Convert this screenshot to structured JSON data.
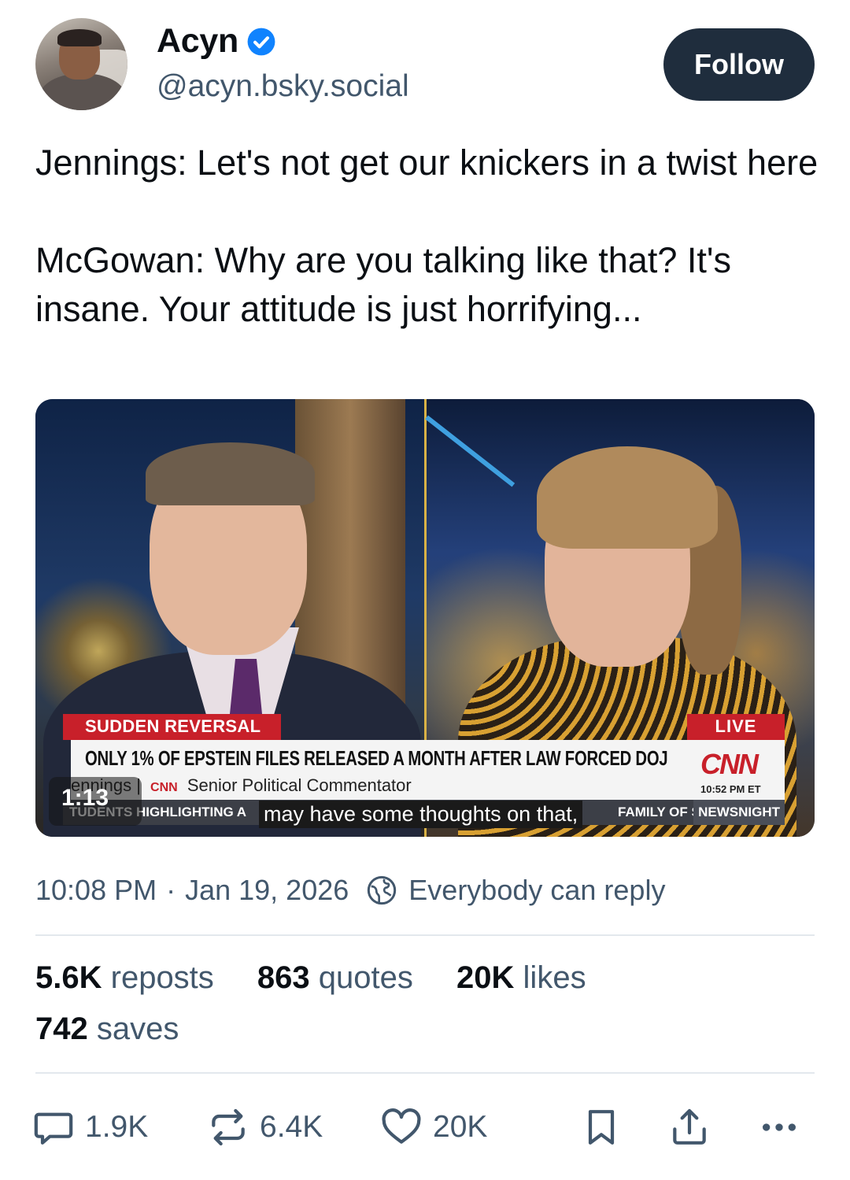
{
  "author": {
    "display_name": "Acyn",
    "handle": "@acyn.bsky.social",
    "verified": true
  },
  "follow_label": "Follow",
  "post": {
    "line1": "Jennings: Let's not get our knickers in a twist here",
    "line2": "McGowan: Why are you talking like that? It's insane. Your attitude is just horrifying..."
  },
  "video": {
    "duration": "1:13",
    "chyron_tag": "SUDDEN REVERSAL",
    "live_label": "LIVE",
    "headline": "ONLY 1% OF EPSTEIN FILES RELEASED A MONTH AFTER LAW FORCED DOJ",
    "speaker_name": "ennings",
    "network_mini": "CNN",
    "speaker_title": "Senior Political Commentator",
    "network_logo": "CNN",
    "broadcast_time": "10:52 PM ET",
    "ticker": "TUDENTS HIGHLIGHTING A",
    "ticker_right": "FAMILY OF SE",
    "show_name": "NEWSNIGHT",
    "caption": "may have some thoughts on that,"
  },
  "meta": {
    "time": "10:08 PM",
    "separator": "·",
    "date": "Jan 19, 2026",
    "reply_setting": "Everybody can reply"
  },
  "stats": {
    "reposts_count": "5.6K",
    "reposts_label": "reposts",
    "quotes_count": "863",
    "quotes_label": "quotes",
    "likes_count": "20K",
    "likes_label": "likes",
    "saves_count": "742",
    "saves_label": "saves"
  },
  "actions": {
    "reply_count": "1.9K",
    "repost_count": "6.4K",
    "like_count": "20K"
  },
  "colors": {
    "follow_bg": "#1f2d3d",
    "verified_blue": "#1083fe",
    "muted_text": "#42576c",
    "cnn_red": "#c8202a"
  }
}
